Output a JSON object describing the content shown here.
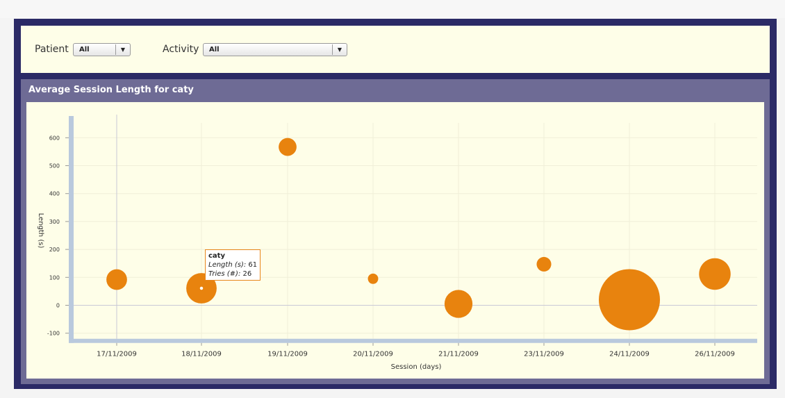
{
  "filters": {
    "patient_label": "Patient",
    "patient_value": "All",
    "activity_label": "Activity",
    "activity_value": "All"
  },
  "panel": {
    "title": "Average Session Length for caty"
  },
  "colors": {
    "bubble": "#e8830e",
    "axis_band": "#b9c9dd",
    "frame": "#2b2a66"
  },
  "icons": {
    "dropdown": "chevron-down-icon"
  },
  "tooltip": {
    "title": "caty",
    "length_label": "Length (s):",
    "length_value": "61",
    "tries_label": "Tries (#):",
    "tries_value": "26"
  },
  "chart_data": {
    "type": "scatter",
    "title": "Average Session Length for caty",
    "xlabel": "Session (days)",
    "ylabel": "Length (s)",
    "ylim": [
      -120,
      680
    ],
    "yticks": [
      -100,
      0,
      100,
      200,
      300,
      400,
      500,
      600
    ],
    "categories": [
      "17/11/2009",
      "18/11/2009",
      "19/11/2009",
      "20/11/2009",
      "21/11/2009",
      "23/11/2009",
      "24/11/2009",
      "26/11/2009"
    ],
    "series": [
      {
        "values": [
          92,
          61,
          567,
          95,
          5,
          147,
          20,
          112
        ],
        "size": [
          12,
          26,
          9,
          3,
          22,
          6,
          105,
          28
        ]
      }
    ]
  }
}
